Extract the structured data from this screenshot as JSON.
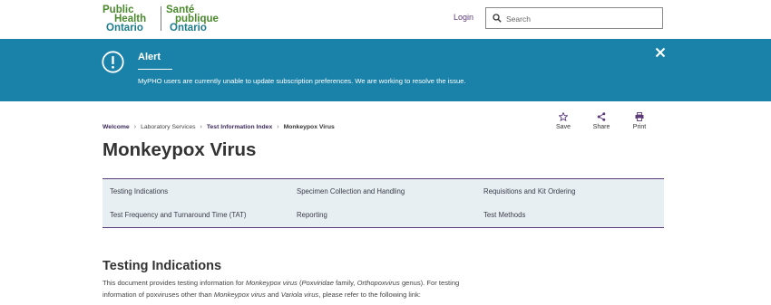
{
  "header": {
    "logo": {
      "en": [
        "Public",
        "Health",
        "Ontario"
      ],
      "fr": [
        "Santé",
        "publique",
        "Ontario"
      ]
    },
    "login_label": "Login",
    "search_placeholder": "Search"
  },
  "alert": {
    "title": "Alert",
    "message": "MyPHO users are currently unable to update subscription preferences. We are working to resolve the issue.",
    "icon": "exclamation-circle-icon",
    "close_icon": "close-icon"
  },
  "breadcrumb": {
    "items": [
      "Welcome",
      "Laboratory Services",
      "Test Information Index",
      "Monkeypox Virus"
    ],
    "separator": "›"
  },
  "actions": {
    "save": "Save",
    "share": "Share",
    "print": "Print"
  },
  "page_title": "Monkeypox Virus",
  "section_nav": {
    "links": [
      "Testing Indications",
      "Specimen Collection and Handling",
      "Requisitions and Kit Ordering",
      "Test Frequency and Turnaround Time (TAT)",
      "Reporting",
      "Test Methods"
    ]
  },
  "content": {
    "heading": "Testing Indications",
    "para": {
      "t1": "This document provides testing information for ",
      "i1": "Monkeypox virus",
      "t2": " (",
      "i2": "Poxviridae",
      "t3": " family, ",
      "i3": "Orthopoxvirus",
      "t4": " genus). For testing information of poxviruses other than ",
      "i4": "Monkeypox virus",
      "t5": " and ",
      "i5": "Variola virus",
      "t6": ", please refer to the following link:"
    }
  },
  "colors": {
    "alert_bg": "#1a82a8",
    "brand_green": "#4a8a2c",
    "brand_teal": "#1c7c8c",
    "link_purple": "#5b3a78",
    "nav_bg": "#e7eff2"
  }
}
